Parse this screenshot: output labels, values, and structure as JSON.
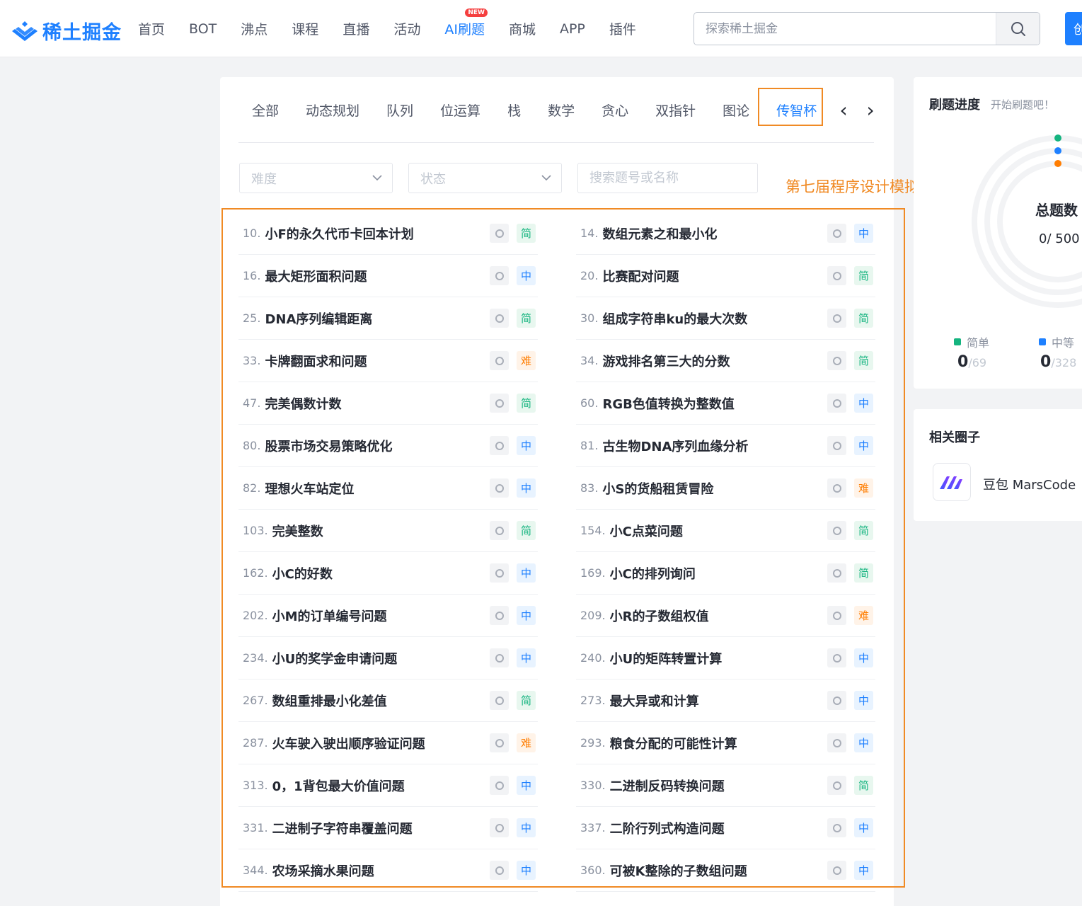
{
  "header": {
    "logo_text": "稀土掘金",
    "nav": [
      {
        "label": "首页"
      },
      {
        "label": "BOT"
      },
      {
        "label": "沸点"
      },
      {
        "label": "课程"
      },
      {
        "label": "直播"
      },
      {
        "label": "活动"
      },
      {
        "label": "AI刷题",
        "active": true,
        "badge": "NEW"
      },
      {
        "label": "商城"
      },
      {
        "label": "APP"
      },
      {
        "label": "插件"
      }
    ],
    "search_placeholder": "探索稀土掘金",
    "create_label": "创"
  },
  "tabs": [
    "全部",
    "动态规划",
    "队列",
    "位运算",
    "栈",
    "数学",
    "贪心",
    "双指针",
    "图论",
    "传智杯"
  ],
  "active_tab": "传智杯",
  "filters": {
    "difficulty_placeholder": "难度",
    "status_placeholder": "状态",
    "search_placeholder": "搜索题号或名称"
  },
  "annotation": "第七届程序设计模拟题",
  "problems": [
    {
      "num": "10.",
      "title": "小F的永久代币卡回本计划",
      "difficulty": "简"
    },
    {
      "num": "14.",
      "title": "数组元素之和最小化",
      "difficulty": "中"
    },
    {
      "num": "16.",
      "title": "最大矩形面积问题",
      "difficulty": "中"
    },
    {
      "num": "20.",
      "title": "比赛配对问题",
      "difficulty": "简"
    },
    {
      "num": "25.",
      "title": "DNA序列编辑距离",
      "difficulty": "简"
    },
    {
      "num": "30.",
      "title": "组成字符串ku的最大次数",
      "difficulty": "简"
    },
    {
      "num": "33.",
      "title": "卡牌翻面求和问题",
      "difficulty": "难"
    },
    {
      "num": "34.",
      "title": "游戏排名第三大的分数",
      "difficulty": "简"
    },
    {
      "num": "47.",
      "title": "完美偶数计数",
      "difficulty": "简"
    },
    {
      "num": "60.",
      "title": "RGB色值转换为整数值",
      "difficulty": "中"
    },
    {
      "num": "80.",
      "title": "股票市场交易策略优化",
      "difficulty": "中"
    },
    {
      "num": "81.",
      "title": "古生物DNA序列血缘分析",
      "difficulty": "中"
    },
    {
      "num": "82.",
      "title": "理想火车站定位",
      "difficulty": "中"
    },
    {
      "num": "83.",
      "title": "小S的货船租赁冒险",
      "difficulty": "难"
    },
    {
      "num": "103.",
      "title": "完美整数",
      "difficulty": "简"
    },
    {
      "num": "154.",
      "title": "小C点菜问题",
      "difficulty": "简"
    },
    {
      "num": "162.",
      "title": "小C的好数",
      "difficulty": "中"
    },
    {
      "num": "169.",
      "title": "小C的排列询问",
      "difficulty": "简"
    },
    {
      "num": "202.",
      "title": "小M的订单编号问题",
      "difficulty": "中"
    },
    {
      "num": "209.",
      "title": "小R的子数组权值",
      "difficulty": "难"
    },
    {
      "num": "234.",
      "title": "小U的奖学金申请问题",
      "difficulty": "中"
    },
    {
      "num": "240.",
      "title": "小U的矩阵转置计算",
      "difficulty": "中"
    },
    {
      "num": "267.",
      "title": "数组重排最小化差值",
      "difficulty": "简"
    },
    {
      "num": "273.",
      "title": "最大异或和计算",
      "difficulty": "中"
    },
    {
      "num": "287.",
      "title": "火车驶入驶出顺序验证问题",
      "difficulty": "难"
    },
    {
      "num": "293.",
      "title": "粮食分配的可能性计算",
      "difficulty": "中"
    },
    {
      "num": "313.",
      "title": "0，1背包最大价值问题",
      "difficulty": "中"
    },
    {
      "num": "330.",
      "title": "二进制反码转换问题",
      "difficulty": "简"
    },
    {
      "num": "331.",
      "title": "二进制子字符串覆盖问题",
      "difficulty": "中"
    },
    {
      "num": "337.",
      "title": "二阶行列式构造问题",
      "difficulty": "中"
    },
    {
      "num": "344.",
      "title": "农场采摘水果问题",
      "difficulty": "中"
    },
    {
      "num": "360.",
      "title": "可被K整除的子数组问题",
      "difficulty": "中"
    }
  ],
  "progress": {
    "title": "刷题进度",
    "subtitle": "开始刷题吧！",
    "total_label": "总题数",
    "total_value": "0/ 500",
    "legend": [
      {
        "label": "简单",
        "solved": "0",
        "total": "/69",
        "color": "#15b47f"
      },
      {
        "label": "中等",
        "solved": "0",
        "total": "/328",
        "color": "#1e80ff"
      }
    ],
    "ring_colors": [
      "#15b47f",
      "#1e80ff",
      "#ff7d00"
    ]
  },
  "circle": {
    "title": "相关圈子",
    "name": "豆包 MarsCode"
  }
}
